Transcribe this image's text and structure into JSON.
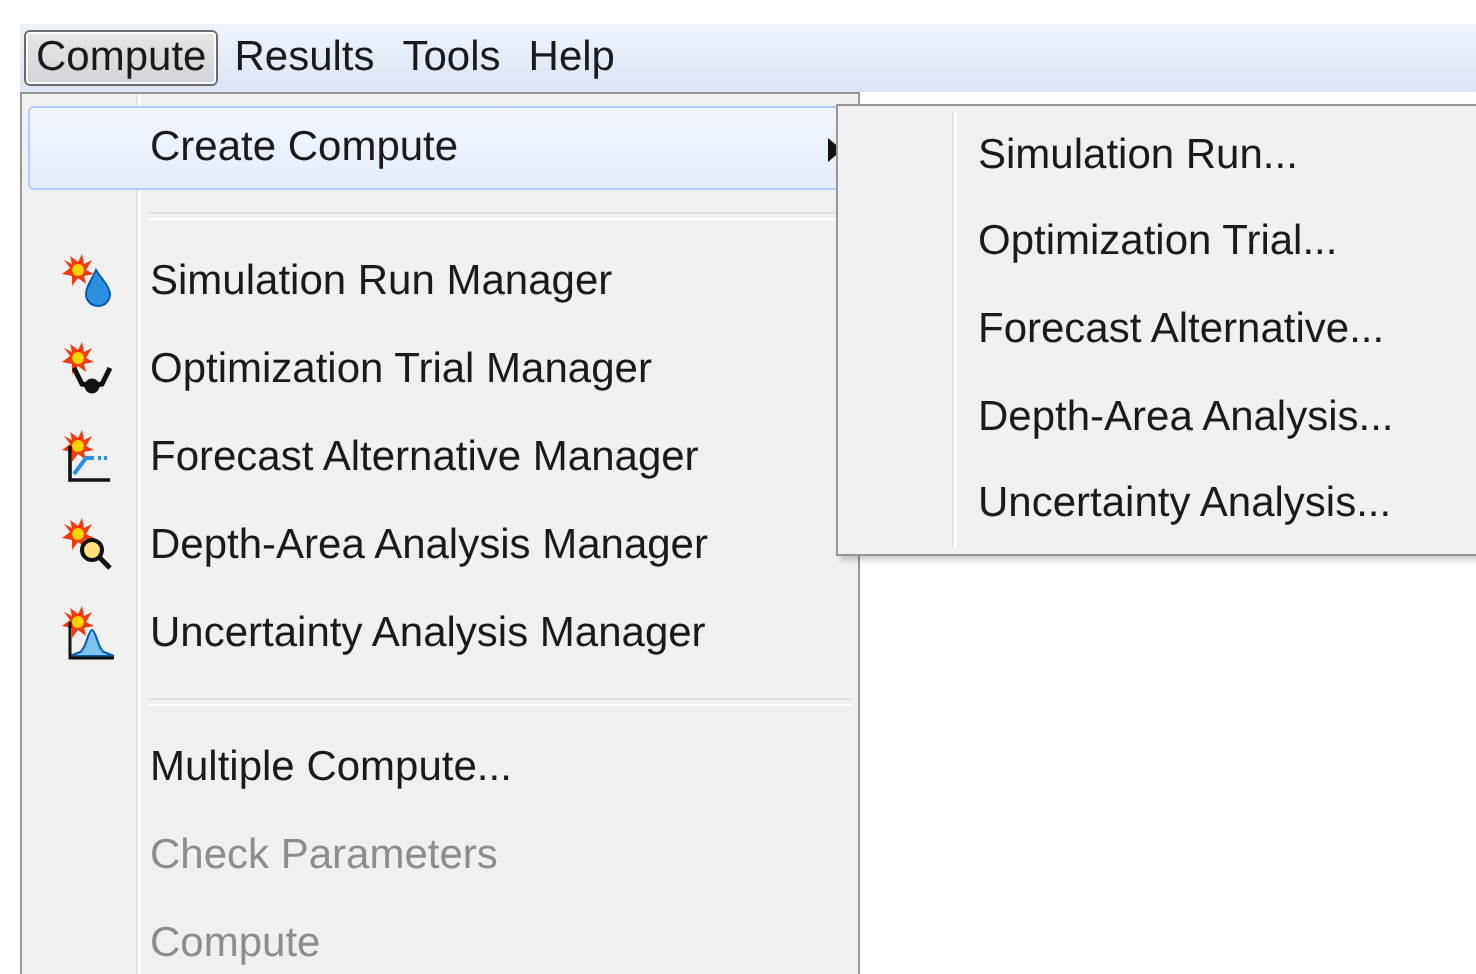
{
  "menubar": [
    {
      "label": "Compute",
      "selected": true
    },
    {
      "label": "Results",
      "selected": false
    },
    {
      "label": "Tools",
      "selected": false
    },
    {
      "label": "Help",
      "selected": false
    }
  ],
  "menu": {
    "items": [
      {
        "kind": "submenu",
        "label": "Create Compute",
        "highlighted": true,
        "disabled": false
      },
      {
        "kind": "separator"
      },
      {
        "kind": "icon-item",
        "label": "Simulation Run Manager",
        "highlighted": false,
        "disabled": false
      },
      {
        "kind": "icon-item",
        "label": "Optimization Trial Manager",
        "highlighted": false,
        "disabled": false
      },
      {
        "kind": "icon-item",
        "label": "Forecast Alternative Manager",
        "highlighted": false,
        "disabled": false
      },
      {
        "kind": "icon-item",
        "label": "Depth-Area Analysis Manager",
        "highlighted": false,
        "disabled": false
      },
      {
        "kind": "icon-item",
        "label": "Uncertainty Analysis Manager",
        "highlighted": false,
        "disabled": false
      },
      {
        "kind": "separator"
      },
      {
        "kind": "item",
        "label": "Multiple Compute...",
        "highlighted": false,
        "disabled": false
      },
      {
        "kind": "item",
        "label": "Check Parameters",
        "highlighted": false,
        "disabled": true
      },
      {
        "kind": "item",
        "label": "Compute",
        "highlighted": false,
        "disabled": true
      }
    ]
  },
  "submenu": {
    "items": [
      {
        "label": "Simulation Run...",
        "disabled": false
      },
      {
        "label": "Optimization Trial...",
        "disabled": false
      },
      {
        "label": "Forecast Alternative...",
        "disabled": false
      },
      {
        "label": "Depth-Area Analysis...",
        "disabled": false
      },
      {
        "label": "Uncertainty Analysis...",
        "disabled": false
      }
    ]
  }
}
